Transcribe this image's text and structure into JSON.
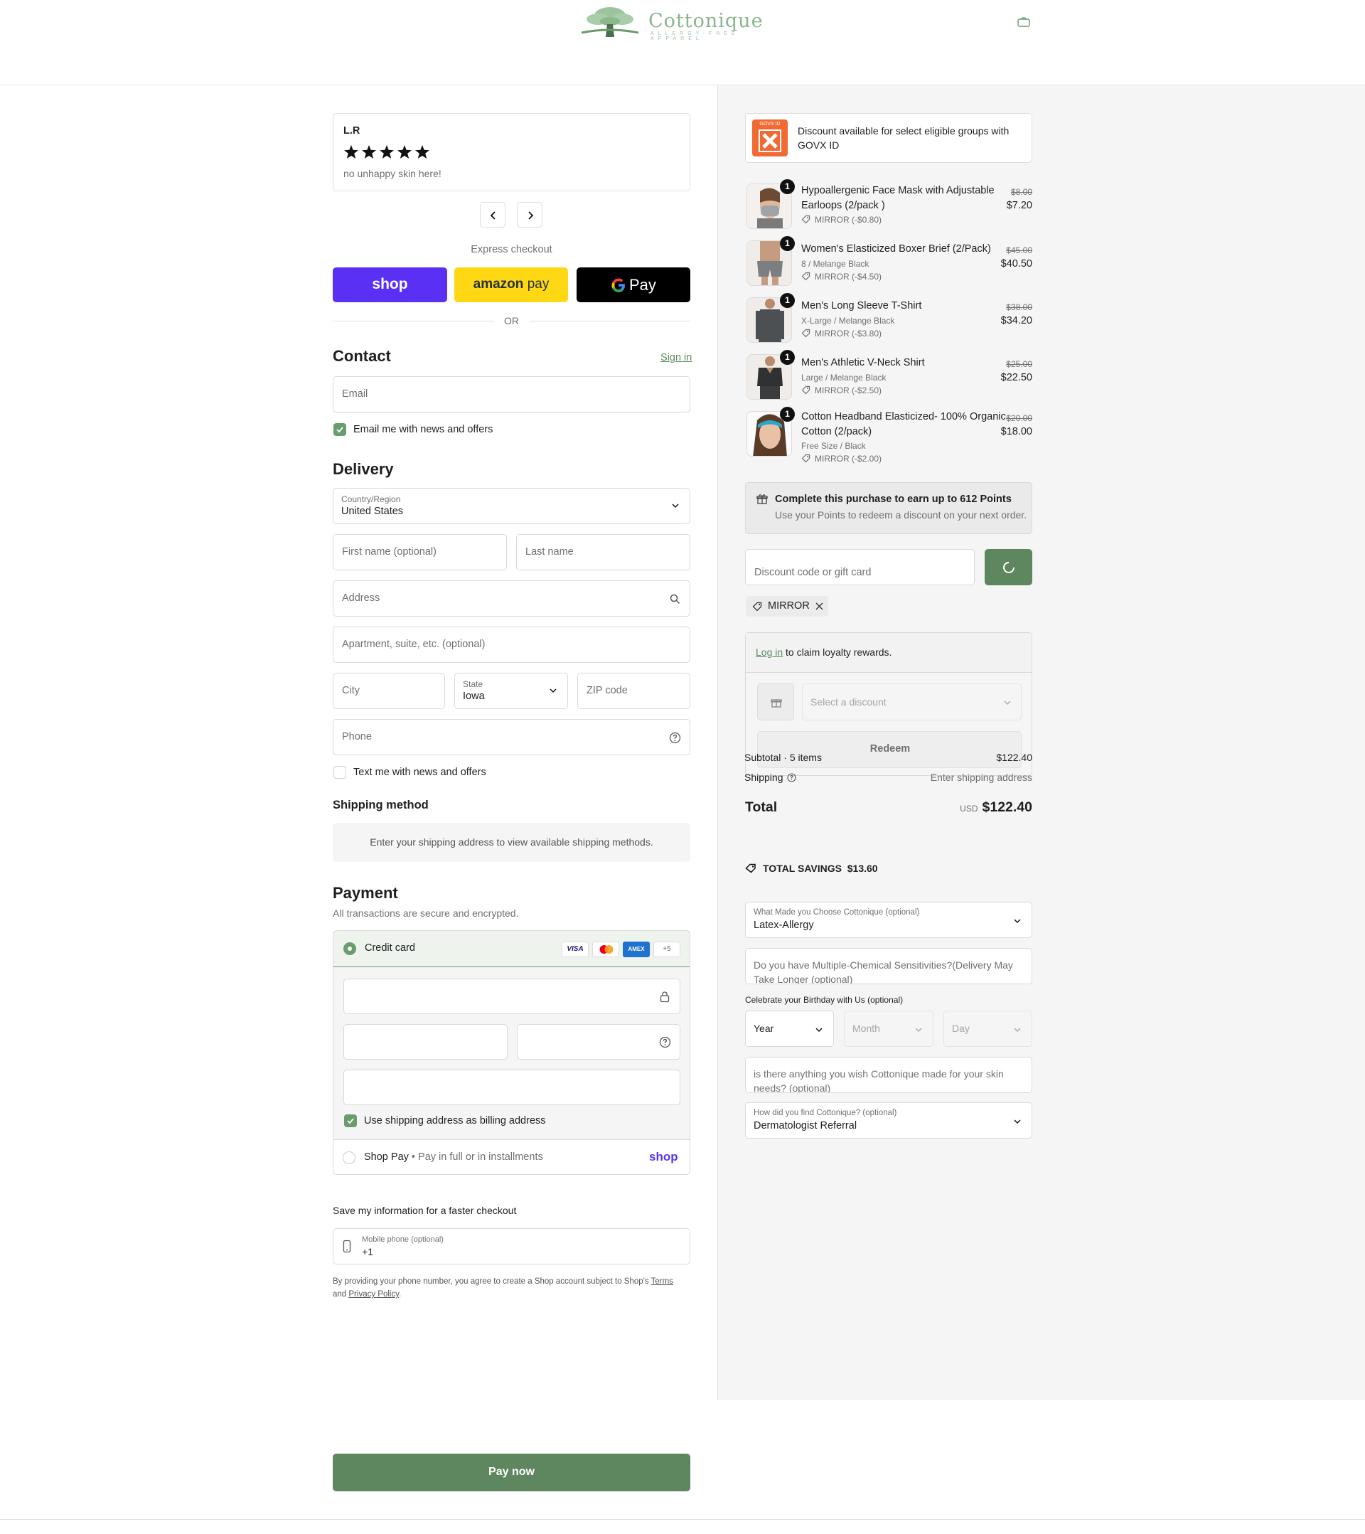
{
  "header": {
    "brand": "Cottonique",
    "tagline": "ALLERGY-FREE APPAREL"
  },
  "review": {
    "author": "L.R",
    "stars": 5,
    "text": "no unhappy skin here!"
  },
  "express": {
    "label": "Express checkout",
    "shop_label": "shop",
    "amazon_label": "amazon",
    "amazon_pay": "pay",
    "gpay_label": "Pay",
    "or": "OR"
  },
  "contact": {
    "title": "Contact",
    "sign_in": "Sign in",
    "email_placeholder": "Email",
    "news_label": "Email me with news and offers"
  },
  "delivery": {
    "title": "Delivery",
    "country_label": "Country/Region",
    "country_value": "United States",
    "first_name": "First name (optional)",
    "last_name": "Last name",
    "address": "Address",
    "apartment": "Apartment, suite, etc. (optional)",
    "city": "City",
    "state_label": "State",
    "state_value": "Iowa",
    "zip": "ZIP code",
    "phone": "Phone",
    "sms_label": "Text me with news and offers"
  },
  "shipping_method": {
    "title": "Shipping method",
    "message": "Enter your shipping address to view available shipping methods."
  },
  "payment": {
    "title": "Payment",
    "subtitle": "All transactions are secure and encrypted.",
    "credit_card": "Credit card",
    "card_badges": [
      "VISA",
      "",
      "AMEX",
      "+5"
    ],
    "billing_label": "Use shipping address as billing address",
    "shop_pay": "Shop Pay",
    "shop_pay_desc": "Pay in full or in installments",
    "shop_logo": "shop"
  },
  "save_info": {
    "title": "Save my information for a faster checkout",
    "mobile_label": "Mobile phone (optional)",
    "mobile_value": "+1",
    "legal_1": "By providing your phone number, you agree to create a Shop account subject to Shop's",
    "terms": "Terms",
    "legal_and": "and",
    "privacy": "Privacy Policy",
    "legal_end": "."
  },
  "pay_now": "Pay now",
  "govx": {
    "logo": "GOVX ID",
    "text": "Discount available for select eligible groups with GOVX ID"
  },
  "products": [
    {
      "qty": "1",
      "name": "Hypoallergenic Face Mask with Adjustable Earloops (2/pack )",
      "variant": "",
      "discount": "MIRROR (-$0.80)",
      "old_price": "$8.00",
      "price": "$7.20"
    },
    {
      "qty": "1",
      "name": "Women's Elasticized Boxer Brief (2/Pack)",
      "variant": "8 / Melange Black",
      "discount": "MIRROR (-$4.50)",
      "old_price": "$45.00",
      "price": "$40.50"
    },
    {
      "qty": "1",
      "name": "Men's Long Sleeve T-Shirt",
      "variant": "X-Large / Melange Black",
      "discount": "MIRROR (-$3.80)",
      "old_price": "$38.00",
      "price": "$34.20"
    },
    {
      "qty": "1",
      "name": "Men's Athletic V-Neck Shirt",
      "variant": "Large / Melange Black",
      "discount": "MIRROR (-$2.50)",
      "old_price": "$25.00",
      "price": "$22.50"
    },
    {
      "qty": "1",
      "name": "Cotton Headband Elasticized- 100% Organic Cotton (2/pack)",
      "variant": "Free Size / Black",
      "discount": "MIRROR (-$2.00)",
      "old_price": "$20.00",
      "price": "$18.00"
    }
  ],
  "points": {
    "title": "Complete this purchase to earn up to 612 Points",
    "subtitle": "Use your Points to redeem a discount on your next order."
  },
  "discount": {
    "placeholder": "Discount code or gift card",
    "applied_code": "MIRROR"
  },
  "loyalty": {
    "log_in": "Log in",
    "text": "to claim loyalty rewards.",
    "select_placeholder": "Select a discount",
    "redeem": "Redeem"
  },
  "totals": {
    "subtotal_label": "Subtotal · 5 items",
    "subtotal": "$122.40",
    "shipping_label": "Shipping",
    "shipping_value": "Enter shipping address",
    "total_label": "Total",
    "currency": "USD",
    "total": "$122.40",
    "savings_label": "TOTAL SAVINGS",
    "savings": "$13.60"
  },
  "survey": {
    "choose_label": "What Made you Choose Cottonique (optional)",
    "choose_value": "Latex-Allergy",
    "mcs_placeholder": "Do you have Multiple-Chemical Sensitivities?(Delivery May Take Longer (optional)",
    "birthday_label": "Celebrate your Birthday with Us (optional)",
    "year": "Year",
    "month": "Month",
    "day": "Day",
    "wish_placeholder": "is there anything you wish Cottonique made for your skin needs? (optional)",
    "found_label": "How did you find Cottonique? (optional)",
    "found_value": "Dermatologist Referral"
  },
  "colors": {
    "accent": "#5f875f",
    "shop_purple": "#5a31f4",
    "amazon_yellow": "#ffd814"
  }
}
